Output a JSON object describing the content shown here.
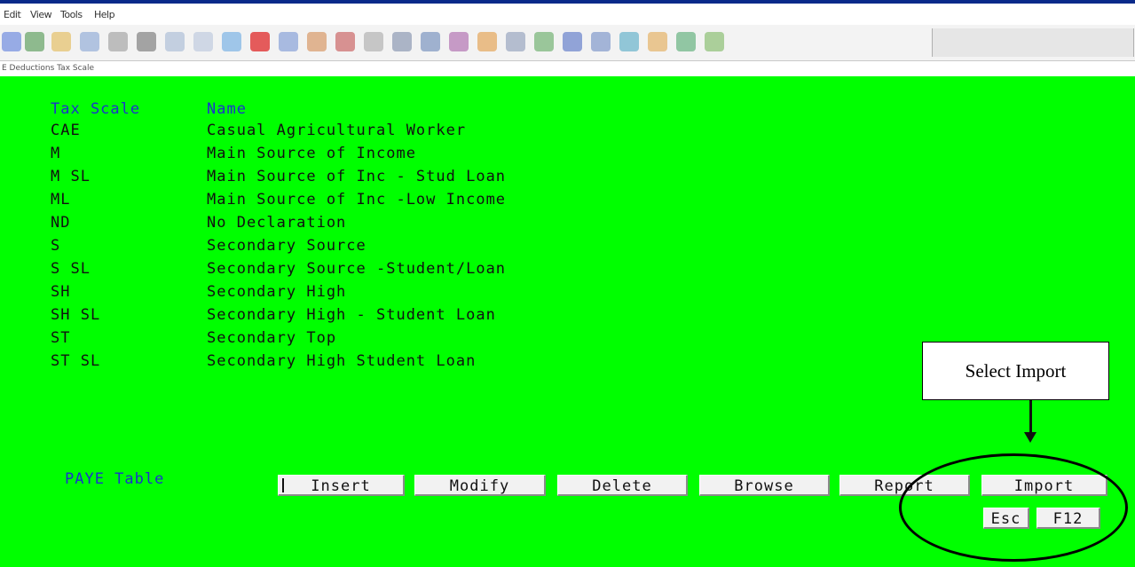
{
  "menubar": {
    "items": [
      "Edit",
      "View",
      "Tools",
      "Help"
    ]
  },
  "window": {
    "title": "E Deductions Tax Scale"
  },
  "table": {
    "headers": {
      "code": "Tax Scale",
      "name": "Name"
    },
    "rows": [
      {
        "code": "CAE",
        "name": "Casual Agricultural Worker"
      },
      {
        "code": "M",
        "name": "Main Source of Income"
      },
      {
        "code": "M SL",
        "name": "Main Source of Inc - Stud Loan"
      },
      {
        "code": "ML",
        "name": "Main Source of Inc -Low Income"
      },
      {
        "code": "ND",
        "name": "No Declaration"
      },
      {
        "code": "S",
        "name": "Secondary Source"
      },
      {
        "code": "S SL",
        "name": "Secondary Source -Student/Loan"
      },
      {
        "code": "SH",
        "name": "Secondary High"
      },
      {
        "code": "SH SL",
        "name": "Secondary High - Student Loan"
      },
      {
        "code": "ST",
        "name": "Secondary Top"
      },
      {
        "code": "ST SL",
        "name": "Secondary High Student Loan"
      }
    ]
  },
  "footer": {
    "label": "PAYE Table",
    "buttons": {
      "insert": "Insert",
      "modify": "Modify",
      "delete": "Delete",
      "browse": "Browse",
      "report": "Report",
      "import": "Import",
      "esc": "Esc",
      "f12": "F12"
    }
  },
  "annotation": {
    "callout": "Select Import"
  },
  "colors": {
    "screen_bg": "#00ff00",
    "header_text": "#1a33cc"
  }
}
